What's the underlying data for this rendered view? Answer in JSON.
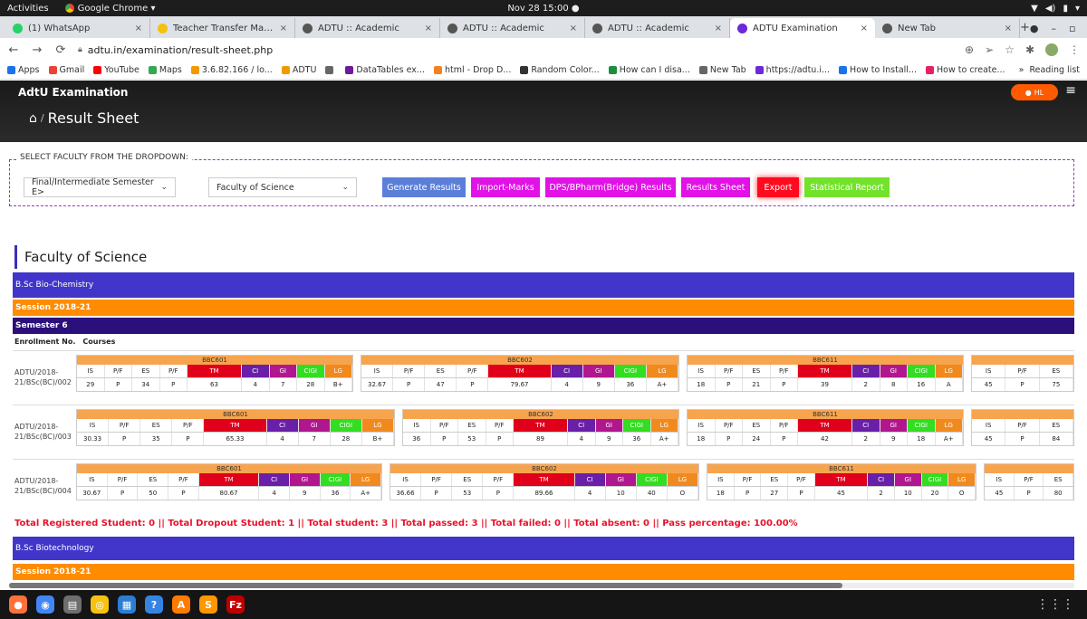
{
  "system": {
    "activities": "Activities",
    "app_name": "Google Chrome ▾",
    "clock": "Nov 28  15:00  ●"
  },
  "tabs": [
    {
      "title": "(1) WhatsApp",
      "active": false,
      "color": "#25d366"
    },
    {
      "title": "Teacher Transfer Manage",
      "active": false,
      "color": "#f4c20d"
    },
    {
      "title": "ADTU :: Academic",
      "active": false,
      "color": "#555555"
    },
    {
      "title": "ADTU :: Academic",
      "active": false,
      "color": "#555555"
    },
    {
      "title": "ADTU :: Academic",
      "active": false,
      "color": "#555555"
    },
    {
      "title": "ADTU Examination",
      "active": true,
      "color": "#6d28d9"
    },
    {
      "title": "New Tab",
      "active": false,
      "color": "#555555"
    }
  ],
  "omnibox": {
    "url": "adtu.in/examination/result-sheet.php"
  },
  "bookmarks": [
    {
      "label": "Apps",
      "color": "#1a73e8"
    },
    {
      "label": "Gmail",
      "color": "#ea4335"
    },
    {
      "label": "YouTube",
      "color": "#ff0000"
    },
    {
      "label": "Maps",
      "color": "#34a853"
    },
    {
      "label": "3.6.82.166 / lo...",
      "color": "#f29900"
    },
    {
      "label": "ADTU",
      "color": "#f29900"
    },
    {
      "label": "",
      "color": "#666666"
    },
    {
      "label": "DataTables ex...",
      "color": "#6a1b9a"
    },
    {
      "label": "html - Drop D...",
      "color": "#f48024"
    },
    {
      "label": "Random Color...",
      "color": "#333333"
    },
    {
      "label": "How can I disa...",
      "color": "#1e8e3e"
    },
    {
      "label": "New Tab",
      "color": "#666666"
    },
    {
      "label": "https://adtu.i...",
      "color": "#6d28d9"
    },
    {
      "label": "How to Install...",
      "color": "#1a73e8"
    },
    {
      "label": "How to create...",
      "color": "#e91e63"
    }
  ],
  "bookmarks_right": {
    "more": "»",
    "reading_list": "Reading list"
  },
  "header": {
    "brand": "AdtU Examination",
    "page_title": "Result Sheet",
    "user_initials": "HL"
  },
  "selector": {
    "legend": "SELECT FACULTY FROM THE DROPDOWN:",
    "exam_select": "Final/Intermediate Semester E>",
    "faculty_select": "Faculty of Science",
    "buttons": {
      "generate": "Generate Results",
      "import": "Import-Marks",
      "dps": "DPS/BPharm(Bridge) Results",
      "sheet": "Results Sheet",
      "export": "Export",
      "stats": "Statistical Report"
    }
  },
  "content": {
    "faculty_title": "Faculty of Science",
    "program_1": "B.Sc Bio-Chemistry",
    "session_1": "Session 2018-21",
    "semester": "Semester 6",
    "col_enrollment": "Enrollment No.",
    "col_courses": "Courses",
    "grade_headers": [
      "IS",
      "P/F",
      "ES",
      "P/F",
      "TM",
      "CI",
      "GI",
      "CIGI",
      "LG"
    ],
    "students": [
      {
        "enrollment": "ADTU/2018-21/BSc(BC)/002",
        "courses": [
          {
            "code": "BBC601",
            "values": [
              "29",
              "P",
              "34",
              "P",
              "63",
              "4",
              "7",
              "28",
              "B+"
            ]
          },
          {
            "code": "BBC602",
            "values": [
              "32.67",
              "P",
              "47",
              "P",
              "79.67",
              "4",
              "9",
              "36",
              "A+"
            ]
          },
          {
            "code": "BBC611",
            "values": [
              "18",
              "P",
              "21",
              "P",
              "39",
              "2",
              "8",
              "16",
              "A"
            ]
          },
          {
            "code": "",
            "values": [
              "45",
              "P",
              "75"
            ]
          }
        ]
      },
      {
        "enrollment": "ADTU/2018-21/BSc(BC)/003",
        "courses": [
          {
            "code": "BBC601",
            "values": [
              "30.33",
              "P",
              "35",
              "P",
              "65.33",
              "4",
              "7",
              "28",
              "B+"
            ]
          },
          {
            "code": "BBC602",
            "values": [
              "36",
              "P",
              "53",
              "P",
              "89",
              "4",
              "9",
              "36",
              "A+"
            ]
          },
          {
            "code": "BBC611",
            "values": [
              "18",
              "P",
              "24",
              "P",
              "42",
              "2",
              "9",
              "18",
              "A+"
            ]
          },
          {
            "code": "",
            "values": [
              "45",
              "P",
              "84"
            ]
          }
        ]
      },
      {
        "enrollment": "ADTU/2018-21/BSc(BC)/004",
        "courses": [
          {
            "code": "BBC601",
            "values": [
              "30.67",
              "P",
              "50",
              "P",
              "80.67",
              "4",
              "9",
              "36",
              "A+"
            ]
          },
          {
            "code": "BBC602",
            "values": [
              "36.66",
              "P",
              "53",
              "P",
              "89.66",
              "4",
              "10",
              "40",
              "O"
            ]
          },
          {
            "code": "BBC611",
            "values": [
              "18",
              "P",
              "27",
              "P",
              "45",
              "2",
              "10",
              "20",
              "O"
            ]
          },
          {
            "code": "",
            "values": [
              "45",
              "P",
              "80"
            ]
          }
        ]
      }
    ],
    "summary": "Total Registered Student: 0 || Total Dropout Student: 1 || Total student: 3 || Total passed: 3 || Total failed: 0 || Total absent: 0 || Pass percentage: 100.00%",
    "program_2": "B.Sc Biotechnology",
    "session_2": "Session 2018-21"
  },
  "dock": [
    {
      "name": "firefox",
      "color": "#ff7139"
    },
    {
      "name": "chrome",
      "color": "#4285f4"
    },
    {
      "name": "files",
      "color": "#6e6e6e"
    },
    {
      "name": "rhythmbox",
      "color": "#f5c211"
    },
    {
      "name": "libreoffice-writer",
      "color": "#2a7fd4"
    },
    {
      "name": "help",
      "color": "#3584e4"
    },
    {
      "name": "software",
      "color": "#ff7b00"
    },
    {
      "name": "sublime-text",
      "color": "#ff9800"
    },
    {
      "name": "filezilla",
      "color": "#bf0000"
    }
  ]
}
